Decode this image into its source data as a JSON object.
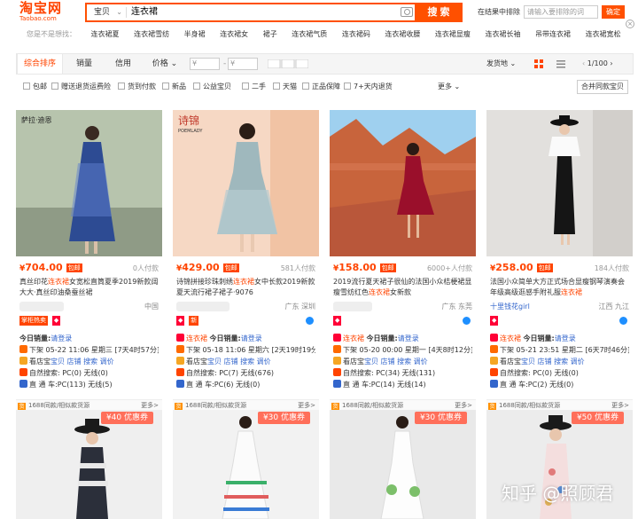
{
  "logo": {
    "main": "淘宝网",
    "sub": "Taobao.com"
  },
  "search": {
    "scope": "宝贝",
    "query": "连衣裙",
    "button": "搜 索"
  },
  "result_search": {
    "label": "在结果中排除",
    "placeholder": "请输入要排除的词",
    "confirm": "确定"
  },
  "suggest": {
    "label": "您是不是想找：",
    "items": [
      "连衣裙夏",
      "连衣裙雪纺",
      "半身裙",
      "连衣裙女",
      "裙子",
      "连衣裙气质",
      "连衣裙码",
      "连衣裙收腰",
      "连衣裙显瘦",
      "连衣裙长袖",
      "吊带连衣裙",
      "连衣裙宽松"
    ]
  },
  "filters": {
    "tabs": [
      "综合排序",
      "销量",
      "信用",
      "价格"
    ],
    "price_from": "¥",
    "price_to": "¥",
    "dash": "-",
    "ship": "发货地",
    "page": "1/100"
  },
  "options": {
    "items": [
      "包邮",
      "赠送退货运费险",
      "货到付款",
      "新品",
      "公益宝贝",
      "二手",
      "天猫",
      "正品保障",
      "7+天内退货"
    ],
    "more": "更多",
    "merge": "合并同款宝贝"
  },
  "products": [
    {
      "price": "704.00",
      "by": "包邮",
      "sold": "0人付款",
      "title_pre": "真丝印花",
      "title_hl": "连衣裙",
      "title_post": "女宽松直筒夏季2019新款阔大大·真丝印油桑蚕丝裙",
      "loc": "中国",
      "badge": "掌柜热卖",
      "sales_label": "今日销量:",
      "sales_link": "请登录",
      "shelf": "下架 05-22 11:06 星期三 [7天4时57分]",
      "store": "看店宝",
      "store2": "宝贝 店铺 搜索 调价",
      "natural": "自然搜索: PC(0) 无线(0)",
      "through": "直 通 车:PC(113) 无线(5)",
      "foot": "1688同款/相似款货源",
      "foot_more": "更多>"
    },
    {
      "price": "429.00",
      "by": "包邮",
      "sold": "581人付款",
      "title_pre": "诗锦拼接珍珠刺绣",
      "title_hl": "连衣裙",
      "title_post": "女中长款2019新款夏天流行裙子裙子·9076",
      "loc": "广东 深圳",
      "badge": "天猫",
      "title_name": "连衣裙",
      "sales_label": "今日销量:",
      "sales_link": "请登录",
      "shelf": "下架 05-18 11:06 星期六 [2天19时19分]",
      "store": "看店宝",
      "store2": "宝贝 店铺 搜索 调价",
      "natural": "自然搜索: PC(7) 无线(676)",
      "through": "直 通 车:PC(6) 无线(0)",
      "foot": "1688同款/相似款货源",
      "foot_more": "更多>"
    },
    {
      "price": "158.00",
      "by": "包邮",
      "sold": "6000+人付款",
      "title_pre": "2019流行夏天裙子很仙的法国小众桔梗裙显瘦雪纺红色",
      "title_hl": "连衣裙",
      "title_post": "女新款",
      "loc": "广东 东莞",
      "badge": "天猫",
      "title_name": "连衣裙",
      "sales_label": "今日销量:",
      "sales_link": "请登录",
      "shelf": "下架 05-20 00:00 星期一 [4天8时12分]",
      "store": "看店宝",
      "store2": "宝贝 店铺 搜索 调价",
      "natural": "自然搜索: PC(34) 无线(131)",
      "through": "直 通 车:PC(14) 无线(14)",
      "foot": "1688同款/相似款货源",
      "foot_more": "更多>"
    },
    {
      "price": "258.00",
      "by": "包邮",
      "sold": "184人付款",
      "title_pre": "法国小众简单大方正式场合显瘦钢琴演奏会年级高级逛感手附礼服",
      "title_hl": "连衣裙",
      "title_post": "",
      "loc": "江西 九江",
      "shop": "十里钱花girl",
      "badge": "天猫",
      "title_name": "连衣裙",
      "sales_label": "今日销量:",
      "sales_link": "请登录",
      "shelf": "下架 05-21 23:51 星期二 [6天7时46分]",
      "store": "看店宝",
      "store2": "宝贝 店铺 搜索 调价",
      "natural": "自然搜索: PC(0) 无线(0)",
      "through": "直 通 车:PC(2) 无线(0)",
      "foot": "1688同款/相似款货源",
      "foot_more": "更多>"
    }
  ],
  "row2": [
    {
      "coupon": "¥40 优惠券"
    },
    {
      "coupon": "¥30 优惠券"
    },
    {
      "coupon": "¥30 优惠券"
    },
    {
      "coupon": "¥50 优惠券"
    }
  ],
  "watermark": "知乎 @照顾君",
  "colors": {
    "accent": "#ff4400",
    "search": "#ff5000",
    "link": "#3366cc"
  }
}
